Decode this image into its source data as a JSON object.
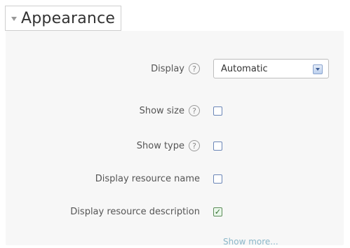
{
  "section": {
    "title": "Appearance"
  },
  "fields": {
    "display": {
      "label": "Display",
      "value": "Automatic"
    },
    "show_size": {
      "label": "Show size",
      "checked": false
    },
    "show_type": {
      "label": "Show type",
      "checked": false
    },
    "display_resource_name": {
      "label": "Display resource name",
      "checked": false
    },
    "display_resource_description": {
      "label": "Display resource description",
      "checked": true
    }
  },
  "links": {
    "show_more": "Show more..."
  },
  "icons": {
    "help": "help-icon",
    "collapse": "caret-down-icon",
    "select": "chevron-down-icon",
    "check": "check-icon"
  },
  "colors": {
    "panel_bg": "#f7f7f7",
    "link": "#8bb7c9",
    "checkbox_border": "#6b86b7",
    "checkbox_checked": "#e9f7ea"
  }
}
